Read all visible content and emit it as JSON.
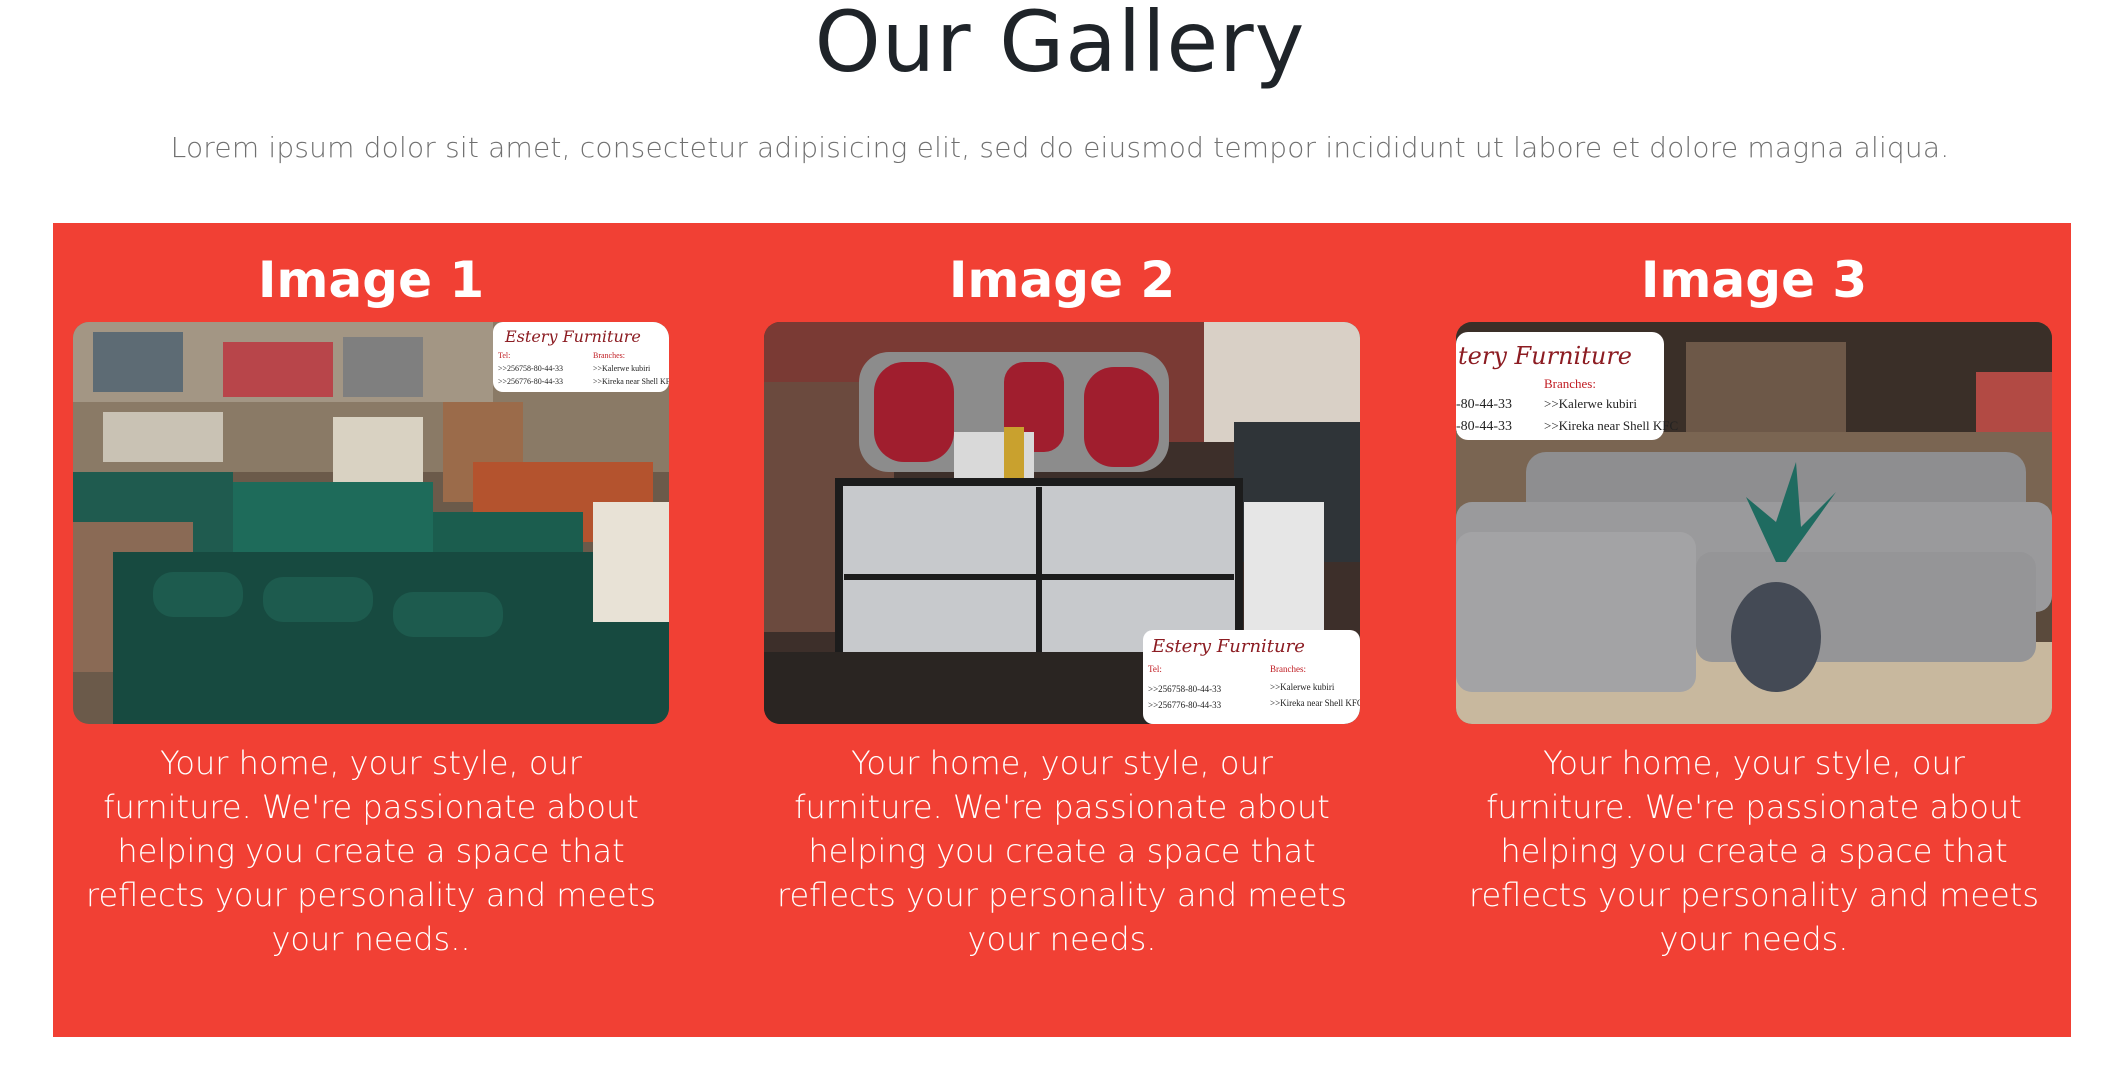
{
  "gallery": {
    "title": "Our Gallery",
    "subtitle": "Lorem ipsum dolor sit amet, consectetur adipisicing elit, sed do eiusmod tempor incididunt ut labore et dolore magna aliqua.",
    "panel_color": "#f14034",
    "items": [
      {
        "title": "Image 1",
        "caption": "Your home, your style, our furniture. We're passionate about helping you create a space that reflects your personality and meets your needs..",
        "sign": {
          "brand": "Estery Furniture",
          "tel_label": "Tel:",
          "phone1": ">>256758-80-44-33",
          "phone2": ">>256776-80-44-33",
          "branches_label": "Branches:",
          "branch1": ">>Kalerwe kubiri",
          "branch2": ">>Kireka near Shell KFC"
        }
      },
      {
        "title": "Image 2",
        "caption": "Your home, your style, our furniture. We're passionate about helping you create a space that reflects your personality and meets your needs.",
        "sign": {
          "brand": "Estery Furniture",
          "tel_label": "Tel:",
          "phone1": ">>256758-80-44-33",
          "phone2": ">>256776-80-44-33",
          "branches_label": "Branches:",
          "branch1": ">>Kalerwe kubiri",
          "branch2": ">>Kireka near Shell KFC"
        }
      },
      {
        "title": "Image 3",
        "caption": "Your home, your style, our furniture. We're passionate about helping you create a space that reflects your personality and meets your needs.",
        "sign": {
          "brand": "tery Furniture",
          "phone1": "-80-44-33",
          "phone2": "-80-44-33",
          "branches_label": "Branches:",
          "branch1": ">>Kalerwe kubiri",
          "branch2": ">>Kireka near Shell KFC"
        }
      }
    ]
  }
}
